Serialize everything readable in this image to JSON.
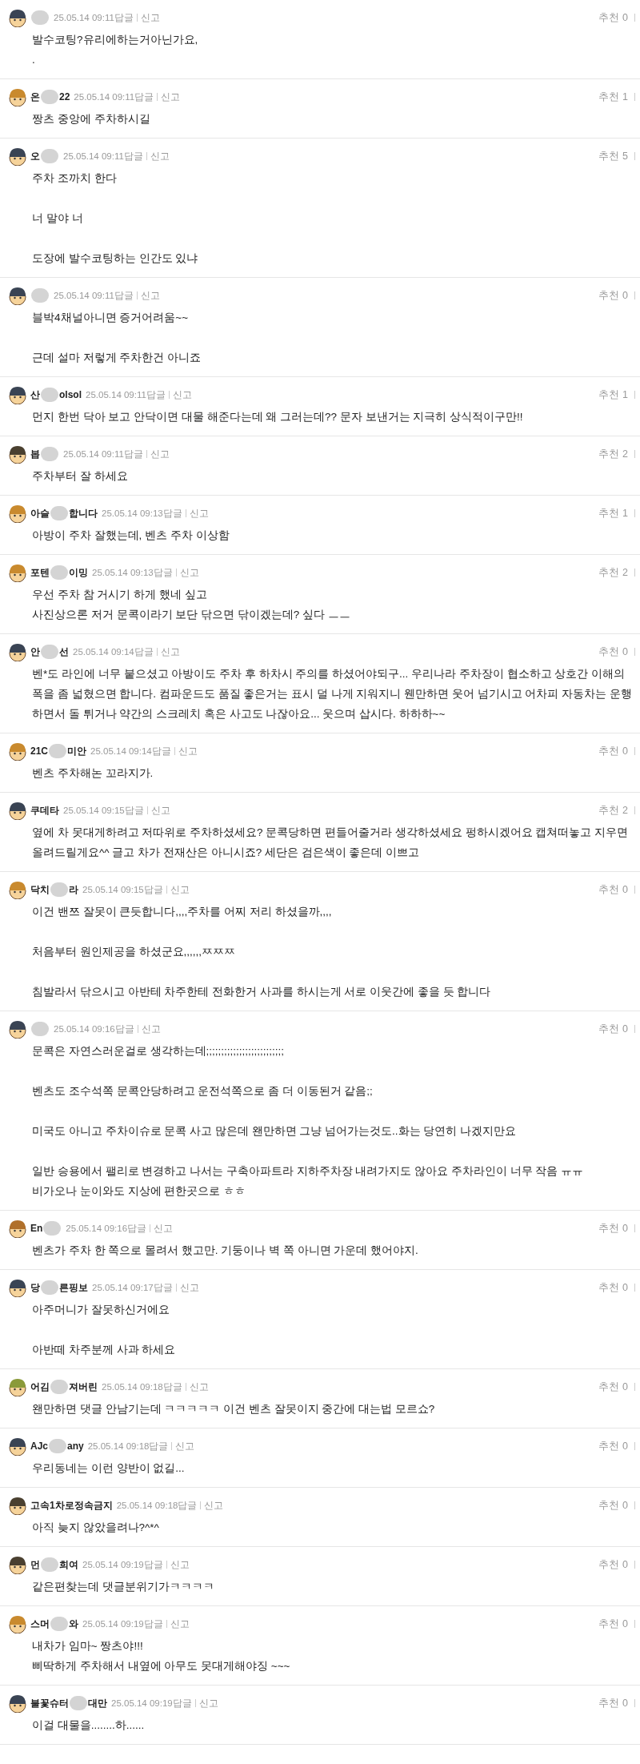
{
  "comments": [
    {
      "blurred": true,
      "color": "#3a4454",
      "date": "25.05.14 09:11",
      "reply": "답글",
      "report": "신고",
      "like_label": "추천",
      "likes": "0",
      "paragraphs": [
        [
          "발수코팅?유리에하는거아닌가요,",
          "."
        ]
      ]
    },
    {
      "name_start": "온",
      "name_end": "22",
      "blurred": true,
      "color": "#c98a2e",
      "date": "25.05.14 09:11",
      "reply": "답글",
      "report": "신고",
      "like_label": "추천",
      "likes": "1",
      "paragraphs": [
        [
          "짱츠 중앙에 주차하시길"
        ]
      ]
    },
    {
      "name_start": "오",
      "blurred": true,
      "color": "#3a4454",
      "date": "25.05.14 09:11",
      "reply": "답글",
      "report": "신고",
      "like_label": "추천",
      "likes": "5",
      "paragraphs": [
        [
          "주차 조까치 한다"
        ],
        [
          "너 말야 너"
        ],
        [
          "도장에 발수코팅하는 인간도 있냐"
        ]
      ]
    },
    {
      "blurred": true,
      "color": "#3a4454",
      "date": "25.05.14 09:11",
      "reply": "답글",
      "report": "신고",
      "like_label": "추천",
      "likes": "0",
      "paragraphs": [
        [
          "블박4채널아니면 증거어려움~~"
        ],
        [
          "근데 설마 저렇게 주차한건 아니죠"
        ]
      ]
    },
    {
      "name_start": "산",
      "name_end": "olsol",
      "blurred": true,
      "color": "#3a4454",
      "date": "25.05.14 09:11",
      "reply": "답글",
      "report": "신고",
      "like_label": "추천",
      "likes": "1",
      "paragraphs": [
        [
          "먼지 한번 닥아 보고 안닥이면 대물 해준다는데 왜 그러는데?? 문자 보낸거는 지극히 상식적이구만!!"
        ]
      ]
    },
    {
      "name_start": "봅",
      "blurred": true,
      "color": "#4a4030",
      "date": "25.05.14 09:11",
      "reply": "답글",
      "report": "신고",
      "like_label": "추천",
      "likes": "2",
      "paragraphs": [
        [
          "주차부터 잘 하세요"
        ]
      ]
    },
    {
      "name_start": "아슬",
      "name_end": "합니다",
      "blurred": true,
      "color": "#c98a2e",
      "date": "25.05.14 09:13",
      "reply": "답글",
      "report": "신고",
      "like_label": "추천",
      "likes": "1",
      "paragraphs": [
        [
          "아방이 주차 잘했는데, 벤츠 주차 이상함"
        ]
      ]
    },
    {
      "name_start": "포텐",
      "name_end": "이밍",
      "blurred": true,
      "color": "#c98a2e",
      "date": "25.05.14 09:13",
      "reply": "답글",
      "report": "신고",
      "like_label": "추천",
      "likes": "2",
      "paragraphs": [
        [
          "우선 주차 참 거시기 하게 했네 싶고",
          "사진상으론 저거 문콕이라기 보단 닦으면 닦이겠는데? 싶다 ㅡㅡ"
        ]
      ]
    },
    {
      "name_start": "안",
      "name_end": "선",
      "blurred": true,
      "color": "#3a4454",
      "date": "25.05.14 09:14",
      "reply": "답글",
      "report": "신고",
      "like_label": "추천",
      "likes": "0",
      "paragraphs": [
        [
          "벤*도 라인에 너무 붙으셨고 아방이도 주차 후 하차시 주의를 하셨어야되구... 우리나라 주차장이 협소하고 상호간 이해의 폭을 좀 넓혔으면 합니다. 컴파운드도 품질 좋은거는 표시 덜 나게 지워지니 웬만하면 웃어 넘기시고 어차피 자동차는 운행하면서 돌 튀거나 약간의 스크레치 혹은 사고도 나잖아요... 웃으며 삽시다. 하하하~~"
        ]
      ]
    },
    {
      "name_start": "21C",
      "name_end": "미안",
      "blurred": true,
      "color": "#c98a2e",
      "date": "25.05.14 09:14",
      "reply": "답글",
      "report": "신고",
      "like_label": "추천",
      "likes": "0",
      "paragraphs": [
        [
          "벤츠 주차해논 꼬라지가."
        ]
      ]
    },
    {
      "name_start": "쿠데타",
      "blurred": false,
      "color": "#3a4454",
      "date": "25.05.14 09:15",
      "reply": "답글",
      "report": "신고",
      "like_label": "추천",
      "likes": "2",
      "paragraphs": [
        [
          "옆에 차 못대게하려고 저따위로 주차하셨세요? 문콕당하면 편들어줄거라 생각하셨세요 펑하시겠어요 캡쳐떠놓고 지우면 올려드릴게요^^ 글고 차가 전재산은 아니시죠? 세단은 검은색이 좋은데 이쁘고"
        ]
      ]
    },
    {
      "name_start": "닥치",
      "name_end": "라",
      "blurred": true,
      "color": "#c98a2e",
      "date": "25.05.14 09:15",
      "reply": "답글",
      "report": "신고",
      "like_label": "추천",
      "likes": "0",
      "paragraphs": [
        [
          "이건 밴쯔 잘못이 큰듯합니다,,,,주차를 어찌 저리 하셨을까,,,,"
        ],
        [
          "처음부터 원인제공을 하셨군요,,,,,,ㅉㅉㅉ"
        ],
        [
          "침발라서 닦으시고 아반테 차주한테 전화한거 사과를 하시는게 서로 이웃간에 좋을 듯 합니다"
        ]
      ]
    },
    {
      "blurred": true,
      "color": "#3a4454",
      "date": "25.05.14 09:16",
      "reply": "답글",
      "report": "신고",
      "like_label": "추천",
      "likes": "0",
      "paragraphs": [
        [
          "문콕은 자연스러운걸로 생각하는데;;;;;;;;;;;;;;;;;;;;;;;;;;"
        ],
        [
          "벤츠도 조수석쪽 문콕안당하려고 운전석쪽으로 좀 더 이동된거 같음;;"
        ],
        [
          "미국도 아니고 주차이슈로 문콕 사고 많은데 왠만하면 그냥 넘어가는것도..화는 당연히 나겠지만요"
        ],
        [
          "일반 승용에서 팰리로 변경하고 나서는 구축아파트라 지하주차장 내려가지도 않아요 주차라인이 너무 작음 ㅠㅠ",
          "비가오나 눈이와도 지상에 편한곳으로 ㅎㅎ"
        ]
      ]
    },
    {
      "name_start": "En",
      "blurred": true,
      "color": "#b0702a",
      "date": "25.05.14 09:16",
      "reply": "답글",
      "report": "신고",
      "like_label": "추천",
      "likes": "0",
      "paragraphs": [
        [
          "벤츠가 주차 한 쪽으로 몰려서 했고만. 기둥이나 벽 쪽 아니면 가운데 했어야지."
        ]
      ]
    },
    {
      "name_start": "당",
      "name_end": "른핑보",
      "blurred": true,
      "color": "#3a4454",
      "date": "25.05.14 09:17",
      "reply": "답글",
      "report": "신고",
      "like_label": "추천",
      "likes": "0",
      "paragraphs": [
        [
          "아주머니가 잘못하신거에요"
        ],
        [
          "아반떼 차주분께 사과 하세요"
        ]
      ]
    },
    {
      "name_start": "어김",
      "name_end": "져버린",
      "blurred": true,
      "color": "#8a9a3a",
      "date": "25.05.14 09:18",
      "reply": "답글",
      "report": "신고",
      "like_label": "추천",
      "likes": "0",
      "paragraphs": [
        [
          "왠만하면 댓글 안남기는데 ㅋㅋㅋㅋㅋ 이건 벤츠 잘못이지 중간에 대는법 모르쇼?"
        ]
      ]
    },
    {
      "name_start": "AJc",
      "name_end": "any",
      "blurred": true,
      "color": "#3a4454",
      "date": "25.05.14 09:18",
      "reply": "답글",
      "report": "신고",
      "like_label": "추천",
      "likes": "0",
      "paragraphs": [
        [
          "우리동네는 이런 양반이 없길..."
        ]
      ]
    },
    {
      "name_start": "고속1차로정속금지",
      "blurred": false,
      "color": "#4a4030",
      "date": "25.05.14 09:18",
      "reply": "답글",
      "report": "신고",
      "like_label": "추천",
      "likes": "0",
      "paragraphs": [
        [
          "아직 늦지 않았을려나?^*^"
        ]
      ]
    },
    {
      "name_start": "먼",
      "name_end": "희여",
      "blurred": true,
      "color": "#4a4030",
      "date": "25.05.14 09:19",
      "reply": "답글",
      "report": "신고",
      "like_label": "추천",
      "likes": "0",
      "paragraphs": [
        [
          "같은편찾는데 댓글분위기가ㅋㅋㅋㅋ"
        ]
      ]
    },
    {
      "name_start": "스머",
      "name_end": "와",
      "blurred": true,
      "color": "#c98a2e",
      "date": "25.05.14 09:19",
      "reply": "답글",
      "report": "신고",
      "like_label": "추천",
      "likes": "0",
      "paragraphs": [
        [
          "내차가 임마~ 짱츠야!!!",
          "삐딱하게 주차해서 내옆에 아무도 못대게해야징 ~~~"
        ]
      ]
    },
    {
      "name_start": "불꽃슈터",
      "name_end": "대만",
      "blurred": true,
      "color": "#3a4454",
      "date": "25.05.14 09:19",
      "reply": "답글",
      "report": "신고",
      "like_label": "추천",
      "likes": "0",
      "paragraphs": [
        [
          "이걸 대물을........하......"
        ]
      ]
    }
  ]
}
